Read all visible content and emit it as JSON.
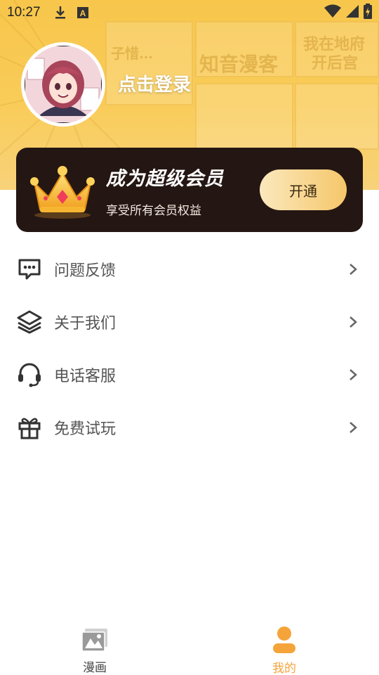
{
  "status_bar": {
    "time": "10:27",
    "icons": [
      "download-icon",
      "a-badge-icon",
      "wifi-icon",
      "signal-icon",
      "battery-icon"
    ]
  },
  "hero": {
    "background_color": "#f8c850",
    "decor_texts": [
      "子惜…",
      "知音漫客",
      "我在地府",
      "开后宫"
    ]
  },
  "profile": {
    "login_label": "点击登录",
    "avatar": "avatar-anime-girl"
  },
  "vip": {
    "title": "成为超级会员",
    "subtitle": "享受所有会员权益",
    "button_label": "开通",
    "crown_icon": "crown-icon",
    "card_color": "#241612",
    "button_gradient": [
      "#fbe8bd",
      "#f5c76a"
    ]
  },
  "menu": {
    "items": [
      {
        "label": "问题反馈",
        "icon": "chat-bubble-icon"
      },
      {
        "label": "关于我们",
        "icon": "layers-icon"
      },
      {
        "label": "电话客服",
        "icon": "headset-icon"
      },
      {
        "label": "免费试玩",
        "icon": "gift-icon"
      }
    ]
  },
  "bottom_nav": {
    "items": [
      {
        "label": "漫画",
        "icon": "comic-image-icon",
        "active": false
      },
      {
        "label": "我的",
        "icon": "user-icon",
        "active": true
      }
    ],
    "active_color": "#f5a43a"
  }
}
